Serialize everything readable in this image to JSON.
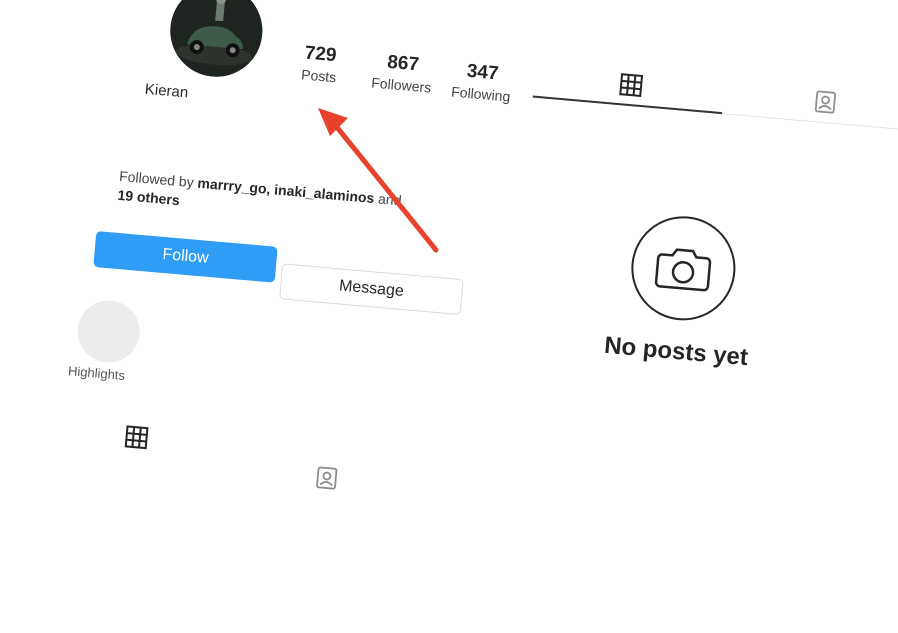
{
  "profile": {
    "username": "Kieran",
    "avatar_icon": "profile-photo-car"
  },
  "stats": {
    "posts_count": "729",
    "posts_label": "Posts",
    "followers_count": "867",
    "followers_label": "Followers",
    "following_count": "347",
    "following_label": "Following"
  },
  "followed_by": {
    "prefix": "Followed by",
    "user1": "marrry_go,",
    "user2": "inaki_alaminos",
    "conjunction": "and",
    "others": "19 others"
  },
  "actions": {
    "follow_label": "Follow",
    "message_label": "Message"
  },
  "highlights": {
    "label": "Highlights"
  },
  "tabs": {
    "grid_icon": "grid-icon",
    "tagged_icon": "tagged-icon"
  },
  "empty_state": {
    "text": "No posts yet",
    "icon": "camera-icon"
  },
  "colors": {
    "follow_button": "#2f9cf5",
    "arrow": "#e8412c"
  }
}
